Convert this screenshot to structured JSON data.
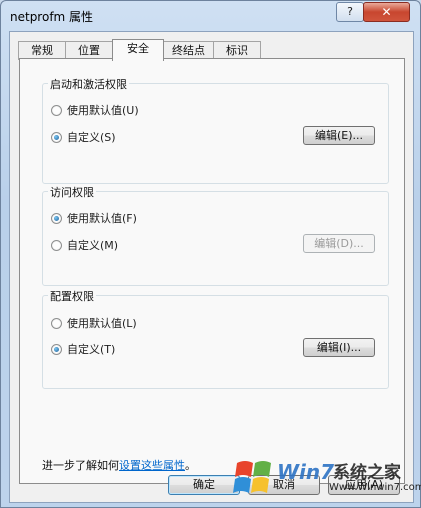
{
  "window": {
    "title": "netprofm 属性",
    "help_glyph": "?",
    "close_glyph": "✕"
  },
  "tabs": [
    {
      "label": "常规"
    },
    {
      "label": "位置"
    },
    {
      "label": "安全"
    },
    {
      "label": "终结点"
    },
    {
      "label": "标识"
    }
  ],
  "active_tab": "安全",
  "groups": {
    "launch": {
      "title": "启动和激活权限",
      "option_default": "使用默认值(U)",
      "option_custom": "自定义(S)",
      "selected": "custom",
      "edit_label": "编辑(E)...",
      "edit_enabled": true
    },
    "access": {
      "title": "访问权限",
      "option_default": "使用默认值(F)",
      "option_custom": "自定义(M)",
      "selected": "default",
      "edit_label": "编辑(D)...",
      "edit_enabled": false
    },
    "config": {
      "title": "配置权限",
      "option_default": "使用默认值(L)",
      "option_custom": "自定义(T)",
      "selected": "custom",
      "edit_label": "编辑(I)...",
      "edit_enabled": true
    }
  },
  "info": {
    "prefix": "进一步了解如何",
    "link": "设置这些属性",
    "suffix": "。"
  },
  "buttons": {
    "ok": "确定",
    "cancel": "取消",
    "apply": "应用(A)"
  },
  "watermark": {
    "brand": "Win7系统之家",
    "site": "Www.Winwin7.com"
  },
  "colors": {
    "link": "#0066cc",
    "close": "#c8462f",
    "selected_radio": "#1c5e96"
  }
}
